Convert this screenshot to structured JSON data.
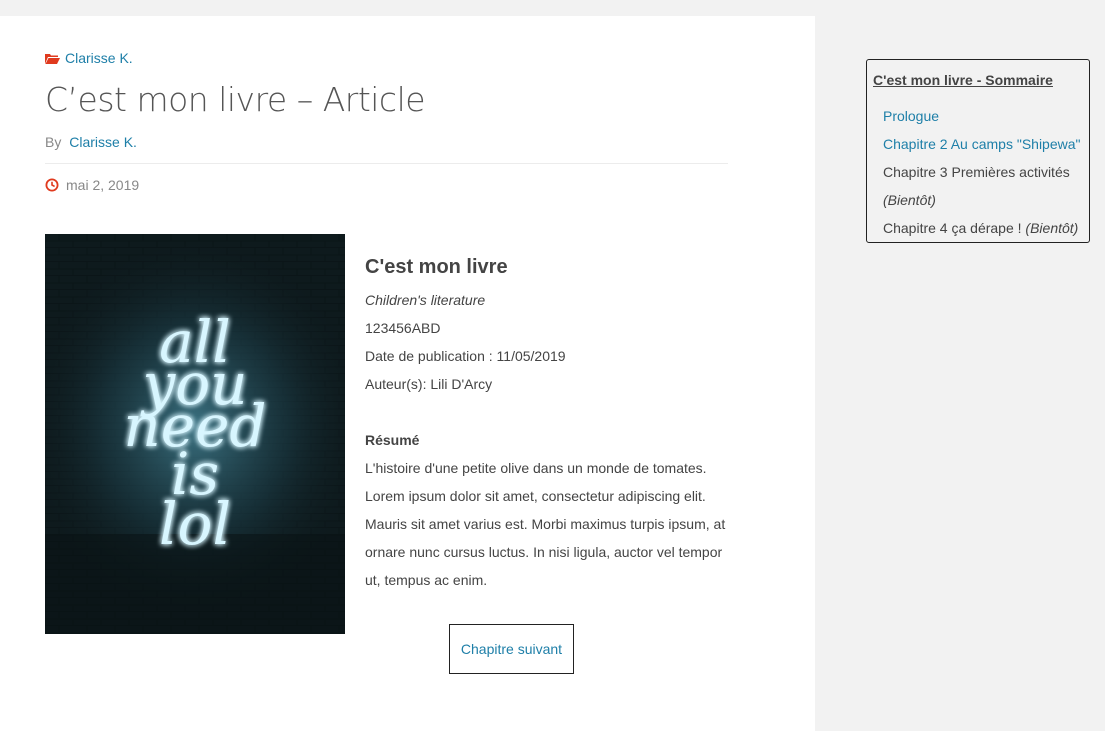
{
  "article": {
    "category": "Clarisse K.",
    "title": "C’est mon livre – Article",
    "by_label": "By",
    "author": "Clarisse K.",
    "date": "mai 2, 2019"
  },
  "book": {
    "title": "C'est mon livre",
    "genre": "Children's literature",
    "isbn": "123456ABD",
    "publication": "Date de publication : 11/05/2019",
    "authors": "Auteur(s): Lili D'Arcy",
    "resume_heading": "Résumé",
    "resume": "L'histoire d'une petite olive dans un monde de tomates. Lorem ipsum dolor sit amet, consectetur adipiscing elit. Mauris sit amet varius est. Morbi maximus turpis ipsum, at ornare nunc cursus luctus. In nisi ligula, auctor vel tempor ut, tempus ac enim.",
    "cover_text": [
      "all",
      "you",
      "need",
      "is",
      "lol"
    ]
  },
  "next_button": "Chapitre suivant",
  "sidebar": {
    "title": "C'est mon livre - Sommaire",
    "items": [
      {
        "label": "Prologue"
      },
      {
        "label": "Chapitre 2 Au camps \"Shipewa\""
      },
      {
        "label": "Chapitre 3 Premières activités",
        "note": "(Bientôt)"
      },
      {
        "label": "Chapitre 4 ça dérape !",
        "note": "(Bientôt)"
      }
    ]
  },
  "colors": {
    "link": "#1e7fa8",
    "icon_accent": "#e03a1e",
    "neon": "#bfefff",
    "cover_bg": "#0e1a1d"
  }
}
